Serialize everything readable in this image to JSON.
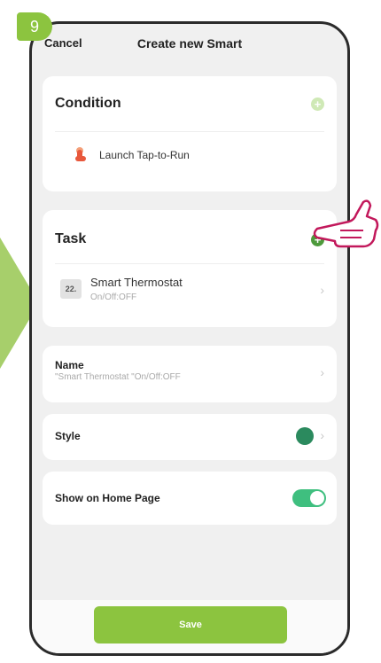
{
  "step_number": "9",
  "accent_color": "#8cc43f",
  "navbar": {
    "cancel_label": "Cancel",
    "title": "Create new Smart"
  },
  "condition": {
    "title": "Condition",
    "add_icon": "plus-circle-icon",
    "item": {
      "icon": "tap-hand-icon",
      "label": "Launch Tap-to-Run"
    }
  },
  "task": {
    "title": "Task",
    "add_icon": "plus-circle-icon",
    "item": {
      "icon": "thermostat-icon",
      "icon_text": "22.",
      "name": "Smart Thermostat",
      "detail": "On/Off:OFF"
    }
  },
  "name_row": {
    "label": "Name",
    "value": "\"Smart Thermostat \"On/Off:OFF"
  },
  "style_row": {
    "label": "Style",
    "icon_color": "#2b8a5e"
  },
  "show_row": {
    "label": "Show on Home Page",
    "toggle_on": true
  },
  "save_label": "Save"
}
